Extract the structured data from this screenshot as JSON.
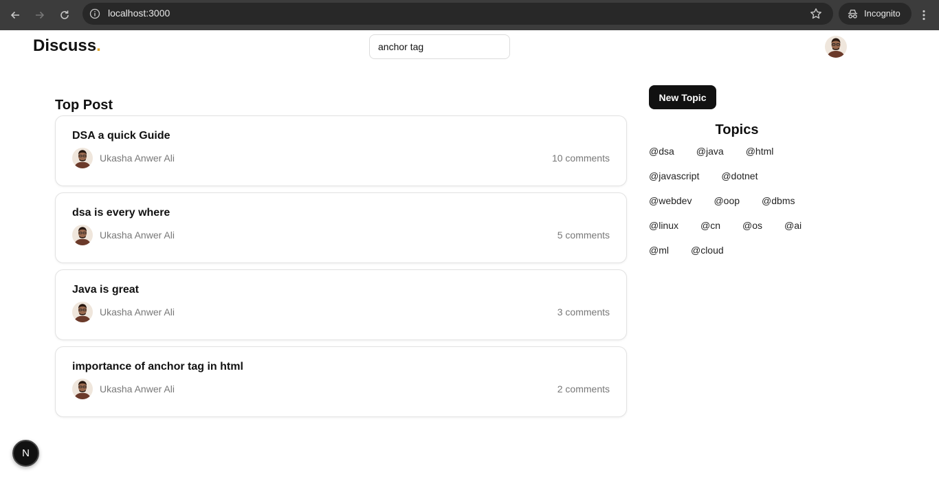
{
  "browser": {
    "url": "localhost:3000",
    "profile_label": "Incognito",
    "icons": [
      "back-arrow-icon",
      "forward-arrow-icon",
      "reload-icon",
      "site-info-icon",
      "bookmark-star-icon",
      "incognito-icon",
      "more-menu-icon"
    ]
  },
  "header": {
    "logo_text": "Discuss",
    "logo_dot": ".",
    "search_value": "anchor tag",
    "accent_color": "#e0a526"
  },
  "main": {
    "section_title": "Top Post",
    "posts": [
      {
        "title": "DSA a quick Guide",
        "author": "Ukasha Anwer Ali",
        "comments": "10 comments"
      },
      {
        "title": "dsa is every where",
        "author": "Ukasha Anwer Ali",
        "comments": "5 comments"
      },
      {
        "title": "Java is great",
        "author": "Ukasha Anwer Ali",
        "comments": "3 comments"
      },
      {
        "title": "importance of anchor tag in html",
        "author": "Ukasha Anwer Ali",
        "comments": "2 comments"
      }
    ]
  },
  "sidebar": {
    "new_topic_label": "New Topic",
    "topics_title": "Topics",
    "topic_rows": [
      [
        "@dsa",
        "@java",
        "@html"
      ],
      [
        "@javascript",
        "@dotnet"
      ],
      [
        "@webdev",
        "@oop",
        "@dbms"
      ],
      [
        "@linux",
        "@cn",
        "@os",
        "@ai"
      ],
      [
        "@ml",
        "@cloud"
      ]
    ]
  },
  "dev_badge": {
    "letter": "N"
  }
}
